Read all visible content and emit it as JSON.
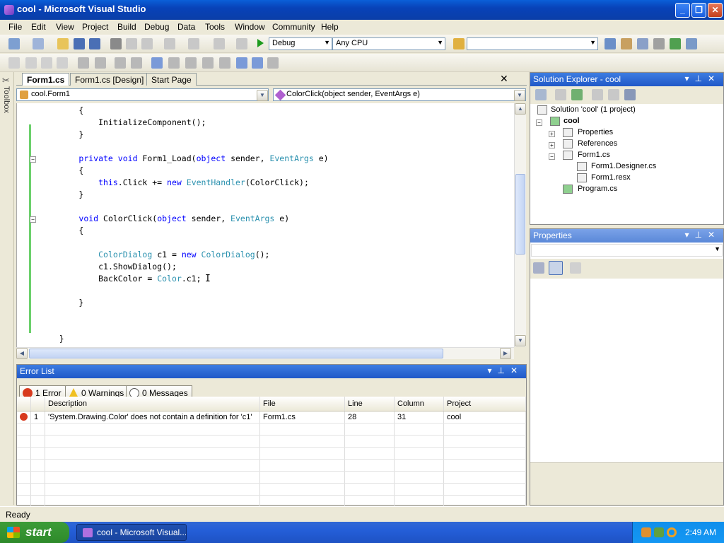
{
  "window": {
    "title": "cool - Microsoft Visual Studio",
    "minimize": "_",
    "maximize": "❐",
    "close": "✕"
  },
  "menu": [
    "File",
    "Edit",
    "View",
    "Project",
    "Build",
    "Debug",
    "Data",
    "Tools",
    "Window",
    "Community",
    "Help"
  ],
  "toolbar": {
    "config": "Debug",
    "platform": "Any CPU",
    "find": ""
  },
  "toolbox": {
    "label": "Toolbox"
  },
  "editor": {
    "tabs": [
      "Form1.cs",
      "Form1.cs [Design]",
      "Start Page"
    ],
    "class_combo": "cool.Form1",
    "member_combo": "ColorClick(object sender, EventArgs e)",
    "lines": [
      {
        "indent": "        ",
        "parts": [
          {
            "t": "{",
            "c": ""
          }
        ]
      },
      {
        "indent": "            ",
        "parts": [
          {
            "t": "InitializeComponent();",
            "c": ""
          }
        ]
      },
      {
        "indent": "        ",
        "parts": [
          {
            "t": "}",
            "c": ""
          }
        ]
      },
      {
        "indent": "",
        "parts": []
      },
      {
        "indent": "        ",
        "parts": [
          {
            "t": "private",
            "c": "kw"
          },
          {
            "t": " ",
            "c": ""
          },
          {
            "t": "void",
            "c": "kw"
          },
          {
            "t": " Form1_Load(",
            "c": ""
          },
          {
            "t": "object",
            "c": "kw"
          },
          {
            "t": " sender, ",
            "c": ""
          },
          {
            "t": "EventArgs",
            "c": "ty"
          },
          {
            "t": " e)",
            "c": ""
          }
        ]
      },
      {
        "indent": "        ",
        "parts": [
          {
            "t": "{",
            "c": ""
          }
        ]
      },
      {
        "indent": "            ",
        "parts": [
          {
            "t": "this",
            "c": "kw"
          },
          {
            "t": ".Click += ",
            "c": ""
          },
          {
            "t": "new",
            "c": "kw"
          },
          {
            "t": " ",
            "c": ""
          },
          {
            "t": "EventHandler",
            "c": "ty"
          },
          {
            "t": "(ColorClick);",
            "c": ""
          }
        ]
      },
      {
        "indent": "        ",
        "parts": [
          {
            "t": "}",
            "c": ""
          }
        ]
      },
      {
        "indent": "",
        "parts": []
      },
      {
        "indent": "        ",
        "parts": [
          {
            "t": "void",
            "c": "kw"
          },
          {
            "t": " ColorClick(",
            "c": ""
          },
          {
            "t": "object",
            "c": "kw"
          },
          {
            "t": " sender, ",
            "c": ""
          },
          {
            "t": "EventArgs",
            "c": "ty"
          },
          {
            "t": " e)",
            "c": ""
          }
        ]
      },
      {
        "indent": "        ",
        "parts": [
          {
            "t": "{",
            "c": ""
          }
        ]
      },
      {
        "indent": "",
        "parts": []
      },
      {
        "indent": "            ",
        "parts": [
          {
            "t": "ColorDialog",
            "c": "ty"
          },
          {
            "t": " c1 = ",
            "c": ""
          },
          {
            "t": "new",
            "c": "kw"
          },
          {
            "t": " ",
            "c": ""
          },
          {
            "t": "ColorDialog",
            "c": "ty"
          },
          {
            "t": "();",
            "c": ""
          }
        ]
      },
      {
        "indent": "            ",
        "parts": [
          {
            "t": "c1.ShowDialog();",
            "c": ""
          }
        ]
      },
      {
        "indent": "            ",
        "parts": [
          {
            "t": "BackColor = ",
            "c": ""
          },
          {
            "t": "Color",
            "c": "ty"
          },
          {
            "t": ".c1;",
            "c": ""
          }
        ]
      },
      {
        "indent": "",
        "parts": []
      },
      {
        "indent": "        ",
        "parts": [
          {
            "t": "}",
            "c": ""
          }
        ]
      },
      {
        "indent": "",
        "parts": []
      },
      {
        "indent": "",
        "parts": []
      },
      {
        "indent": "    ",
        "parts": [
          {
            "t": "}",
            "c": ""
          }
        ]
      }
    ]
  },
  "error_list": {
    "title": "Error List",
    "filters": {
      "errors": "1 Error",
      "warnings": "0 Warnings",
      "messages": "0 Messages"
    },
    "columns": [
      "",
      "",
      "Description",
      "File",
      "Line",
      "Column",
      "Project"
    ],
    "rows": [
      {
        "num": "1",
        "description": "'System.Drawing.Color' does not contain a definition for 'c1'",
        "file": "Form1.cs",
        "line": "28",
        "column": "31",
        "project": "cool"
      }
    ]
  },
  "solution_explorer": {
    "title": "Solution Explorer - cool",
    "items": [
      {
        "label": "Solution 'cool' (1 project)",
        "bold": false
      },
      {
        "label": "cool",
        "bold": true
      },
      {
        "label": "Properties",
        "bold": false
      },
      {
        "label": "References",
        "bold": false
      },
      {
        "label": "Form1.cs",
        "bold": false
      },
      {
        "label": "Form1.Designer.cs",
        "bold": false
      },
      {
        "label": "Form1.resx",
        "bold": false
      },
      {
        "label": "Program.cs",
        "bold": false
      }
    ]
  },
  "properties": {
    "title": "Properties",
    "object": ""
  },
  "status": {
    "text": "Ready"
  },
  "taskbar": {
    "start": "start",
    "task": "cool - Microsoft Visual...",
    "time": "2:49 AM"
  }
}
